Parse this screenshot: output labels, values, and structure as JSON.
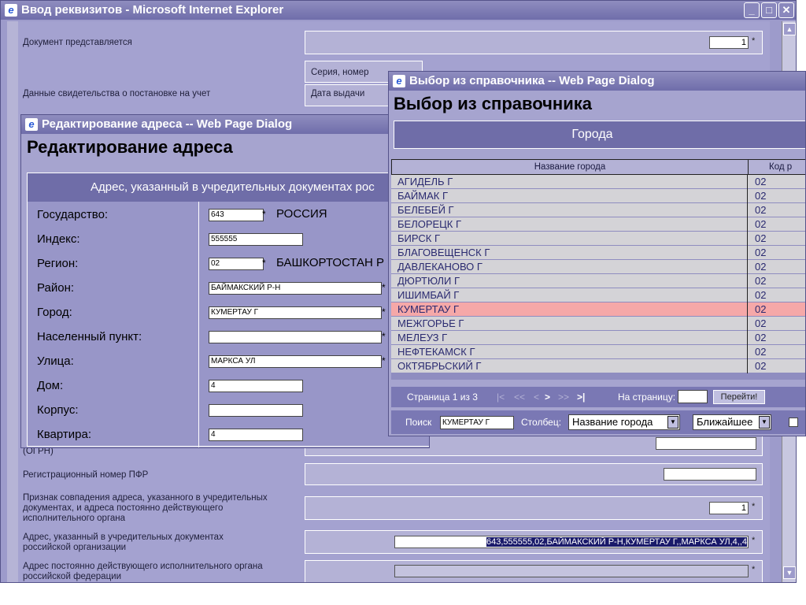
{
  "main": {
    "title": "Ввод реквизитов - Microsoft Internet Explorer",
    "doc_label": "Документ представляется",
    "doc_value": "1",
    "cert_label": "Данные свидетельства о постановке на учет",
    "series_label": "Серия, номер",
    "issue_date_label": "Дата выдачи",
    "ogrn_partial": "(ОГРН)",
    "pfr_label": "Регистрационный номер ПФР",
    "match_label": "Признак совпадения адреса, указанного в учредительных документах, и адреса постоянно действующего исполнительного органа",
    "match_value": "1",
    "addr_label": "Адрес, указанный в учредительных документах российской организации",
    "addr_value": "643,555555,02,БАЙМАКСКИЙ Р-Н,КУМЕРТАУ Г,,МАРКСА УЛ,4,,4",
    "exec_label": "Адрес постоянно действующего исполнительного органа российской федерации",
    "star": "*"
  },
  "addr_dialog": {
    "title": "Редактирование адреса -- Web Page Dialog",
    "heading": "Редактирование адреса",
    "section_header": "Адрес, указанный в учредительных документах рос",
    "fields": {
      "country_label": "Государство:",
      "country_code": "643",
      "country_name": "РОССИЯ",
      "index_label": "Индекс:",
      "index_value": "555555",
      "region_label": "Регион:",
      "region_code": "02",
      "region_name": "БАШКОРТОСТАН Р",
      "district_label": "Район:",
      "district_value": "БАЙМАКСКИЙ Р-Н",
      "city_label": "Город:",
      "city_value": "КУМЕРТАУ Г",
      "locality_label": "Населенный пункт:",
      "locality_value": "",
      "street_label": "Улица:",
      "street_value": "МАРКСА УЛ",
      "house_label": "Дом:",
      "house_value": "4",
      "building_label": "Корпус:",
      "building_value": "",
      "apartment_label": "Квартира:",
      "apartment_value": "4"
    }
  },
  "cat_dialog": {
    "title": "Выбор из справочника -- Web Page Dialog",
    "heading": "Выбор из справочника",
    "banner": "Города",
    "col_name": "Название города",
    "col_code": "Код р",
    "rows": [
      {
        "name": "АГИДЕЛЬ Г",
        "code": "02"
      },
      {
        "name": "БАЙМАК Г",
        "code": "02"
      },
      {
        "name": "БЕЛЕБЕЙ Г",
        "code": "02"
      },
      {
        "name": "БЕЛОРЕЦК Г",
        "code": "02"
      },
      {
        "name": "БИРСК Г",
        "code": "02"
      },
      {
        "name": "БЛАГОВЕЩЕНСК Г",
        "code": "02"
      },
      {
        "name": "ДАВЛЕКАНОВО Г",
        "code": "02"
      },
      {
        "name": "ДЮРТЮЛИ Г",
        "code": "02"
      },
      {
        "name": "ИШИМБАЙ Г",
        "code": "02"
      },
      {
        "name": "КУМЕРТАУ Г",
        "code": "02"
      },
      {
        "name": "МЕЖГОРЬЕ Г",
        "code": "02"
      },
      {
        "name": "МЕЛЕУЗ Г",
        "code": "02"
      },
      {
        "name": "НЕФТЕКАМСК Г",
        "code": "02"
      },
      {
        "name": "ОКТЯБРЬСКИЙ Г",
        "code": "02"
      }
    ],
    "selected_index": 9,
    "pager": {
      "page_text": "Страница 1 из 3",
      "first": "|<",
      "prev_many": "<<",
      "prev": "<",
      "next": ">",
      "next_many": ">>",
      "last": ">|",
      "goto_label": "На страницу:",
      "goto_value": "",
      "goto_button": "Перейти!"
    },
    "search": {
      "label": "Поиск",
      "value": "КУМЕРТАУ Г",
      "column_label": "Столбец:",
      "column_value": "Название города",
      "mode_value": "Ближайшее"
    }
  }
}
